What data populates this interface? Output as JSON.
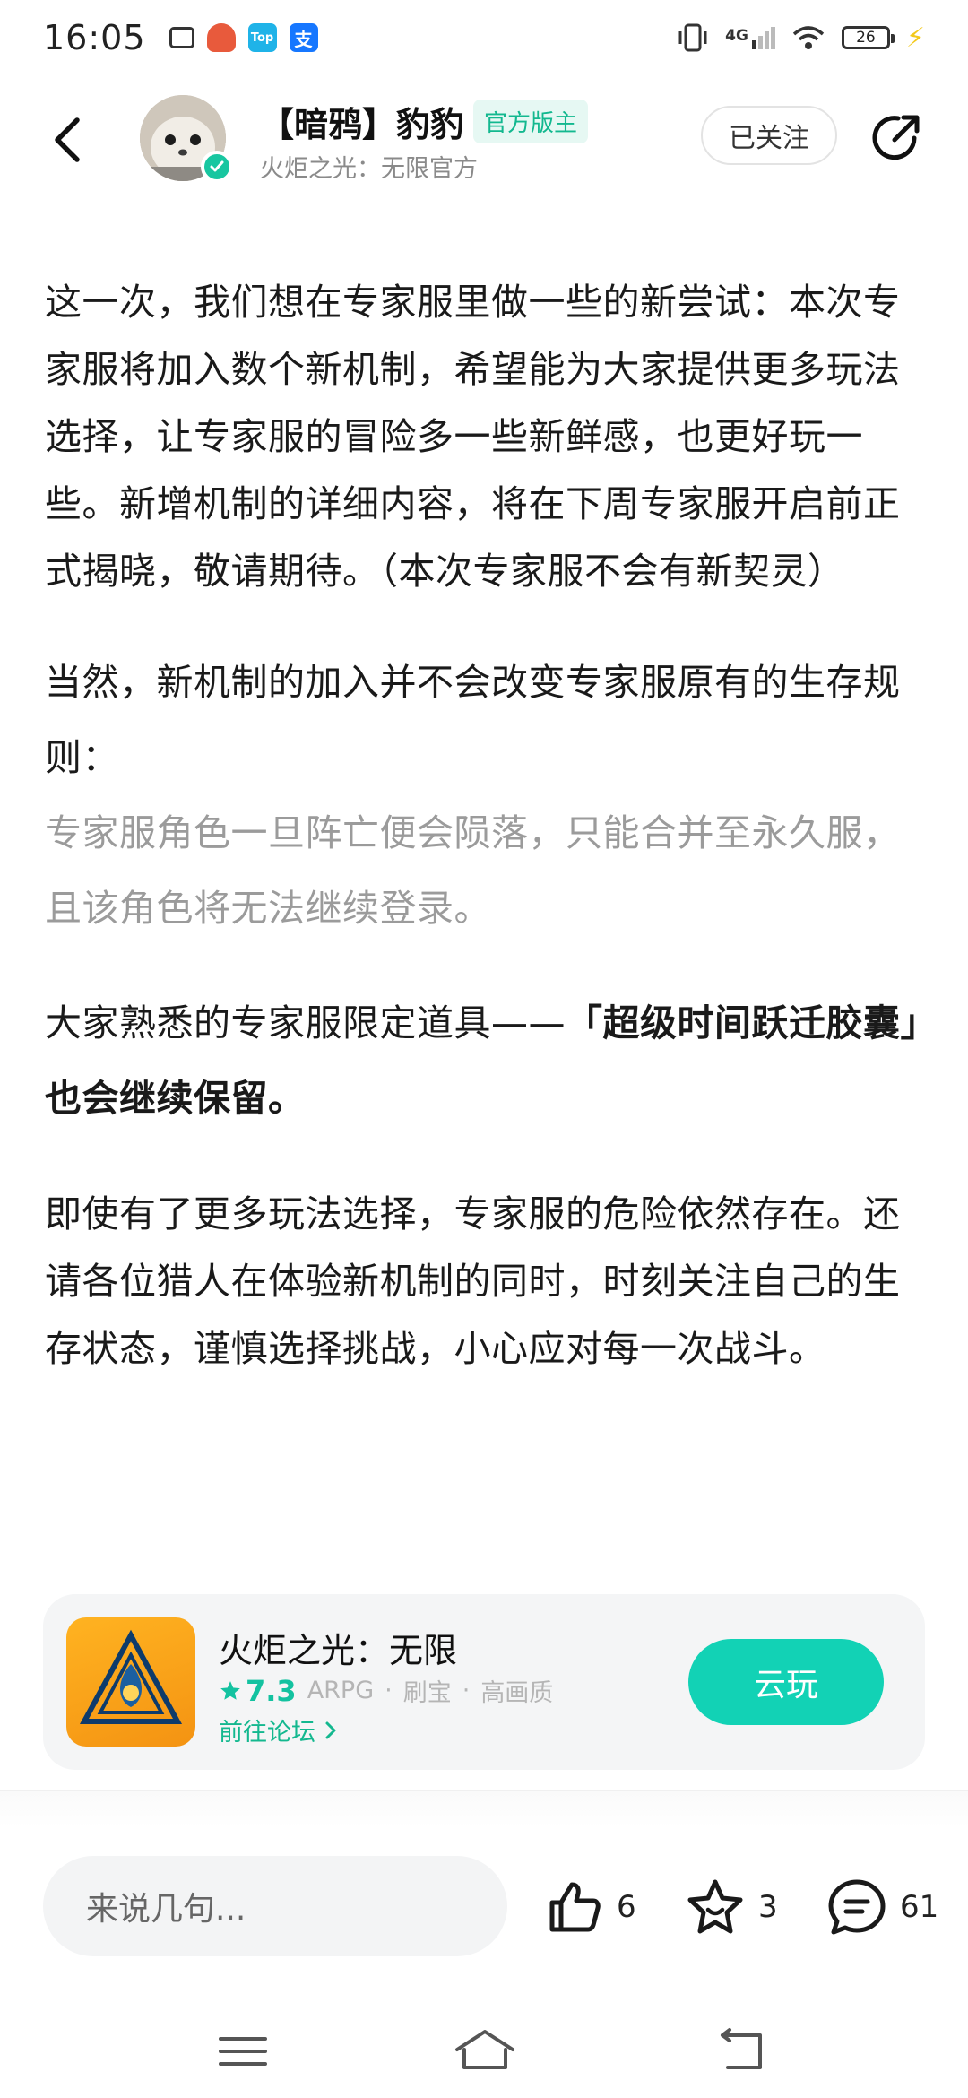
{
  "status_bar": {
    "time": "16:05",
    "apps": [
      "tv-icon",
      "game-icon",
      "top-icon",
      "alipay-icon"
    ],
    "app_labels": {
      "top": "Top",
      "pay": "支"
    },
    "network": "4G",
    "battery": "26"
  },
  "header": {
    "author_name": "【暗鸦】豹豹",
    "role_badge": "官方版主",
    "author_subtitle": "火炬之光：无限官方",
    "follow_label": "已关注"
  },
  "article": {
    "paragraph_1": "这一次，我们想在专家服里做一些的新尝试：本次专家服将加入数个新机制，希望能为大家提供更多玩法选择，让专家服的冒险多一些新鲜感，也更好玩一些。新增机制的详细内容，将在下周专家服开启前正式揭晓，敬请期待。（本次专家服不会有新契灵）",
    "paragraph_2": "当然，新机制的加入并不会改变专家服原有的生存规则：",
    "paragraph_2_gray": "专家服角色一旦阵亡便会陨落，只能合并至永久服，且该角色将无法继续登录。",
    "paragraph_3_normal": "大家熟悉的专家服限定道具——",
    "paragraph_3_bold": "「超级时间跃迁胶囊」也会继续保留。",
    "paragraph_4": "即使有了更多玩法选择，专家服的危险依然存在。还请各位猎人在体验新机制的同时，时刻关注自己的生存状态，谨慎选择挑战，小心应对每一次战斗。"
  },
  "app_card": {
    "name": "火炬之光：无限",
    "rating": "7.3",
    "tags": [
      "ARPG",
      "刷宝",
      "高画质"
    ],
    "separator": "·",
    "forum_link": "前往论坛",
    "play_button": "云玩"
  },
  "bottom_bar": {
    "comment_placeholder": "来说几句...",
    "like_count": "6",
    "favorite_count": "3",
    "comment_count": "61"
  },
  "colors": {
    "accent": "#12d2b5",
    "badge_text": "#13b88f",
    "gray_text": "#9b9b9b"
  }
}
